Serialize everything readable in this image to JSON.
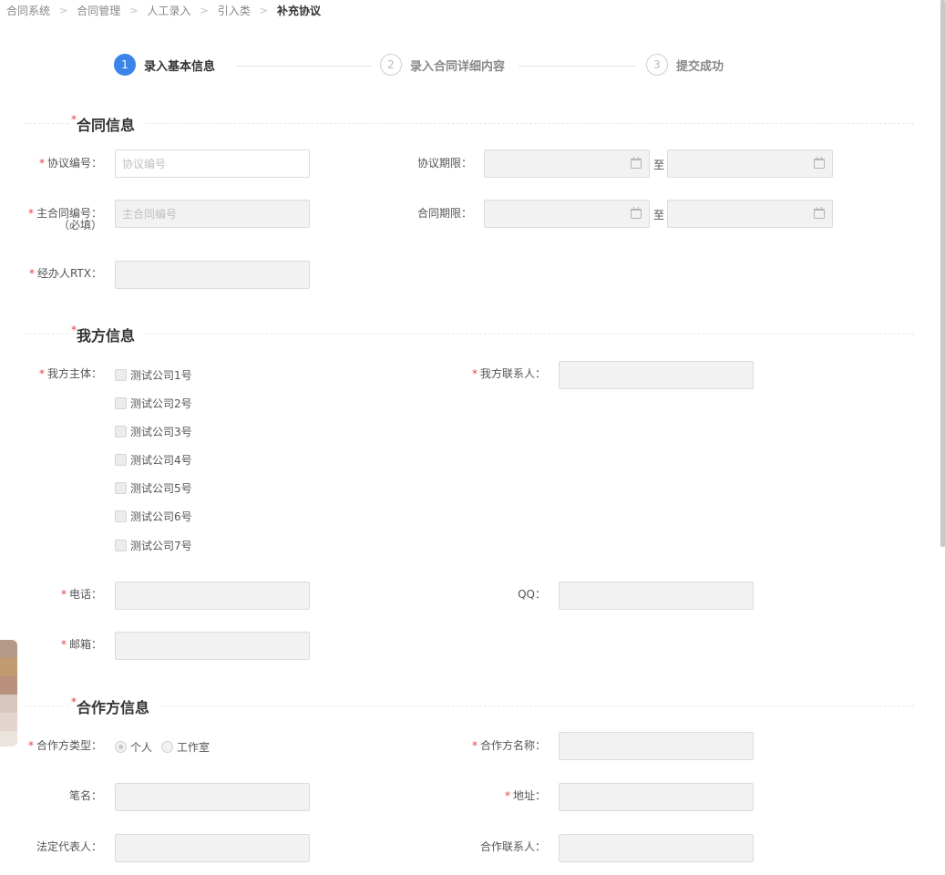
{
  "breadcrumb": [
    "合同系统",
    "合同管理",
    "人工录入",
    "引入类",
    "补充协议"
  ],
  "breadcrumb_separator": ">",
  "steps": [
    {
      "num": "1",
      "label": "录入基本信息",
      "state": "active"
    },
    {
      "num": "2",
      "label": "录入合同详细内容",
      "state": "pending"
    },
    {
      "num": "3",
      "label": "提交成功",
      "state": "pending"
    }
  ],
  "contract_section": {
    "title": "合同信息",
    "agreement_no": {
      "label": "协议编号：",
      "placeholder": "协议编号"
    },
    "agreement_period": {
      "label": "协议期限：",
      "to": "至"
    },
    "main_contract_no": {
      "label": "主合同编号：",
      "sublabel": "（必填）",
      "placeholder": "主合同编号"
    },
    "contract_period": {
      "label": "合同期限：",
      "to": "至"
    },
    "handler_rtx": {
      "label": "经办人RTX："
    }
  },
  "our_section": {
    "title": "我方信息",
    "entity_label": "我方主体：",
    "entities": [
      "测试公司1号",
      "测试公司2号",
      "测试公司3号",
      "测试公司4号",
      "测试公司5号",
      "测试公司6号",
      "测试公司7号"
    ],
    "contact_label": "我方联系人：",
    "phone_label": "电话：",
    "qq_label": "QQ：",
    "email_label": "邮箱："
  },
  "partner_section": {
    "title": "合作方信息",
    "type_label": "合作方类型：",
    "type_options": [
      "个人",
      "工作室"
    ],
    "type_selected": "个人",
    "name_label": "合作方名称：",
    "pen_name_label": "笔名：",
    "address_label": "地址：",
    "legal_rep_label": "法定代表人：",
    "partner_contact_label": "合作联系人："
  },
  "colors": {
    "accent": "#3b84e9",
    "required_star": "#e84040",
    "input_disabled_bg": "#f2f2f2",
    "input_border": "#dcdcdc",
    "swatches": [
      "#b49a86",
      "#c29a70",
      "#b9917d",
      "#d8c7bd",
      "#e3d5cd",
      "#ebe3de"
    ]
  }
}
